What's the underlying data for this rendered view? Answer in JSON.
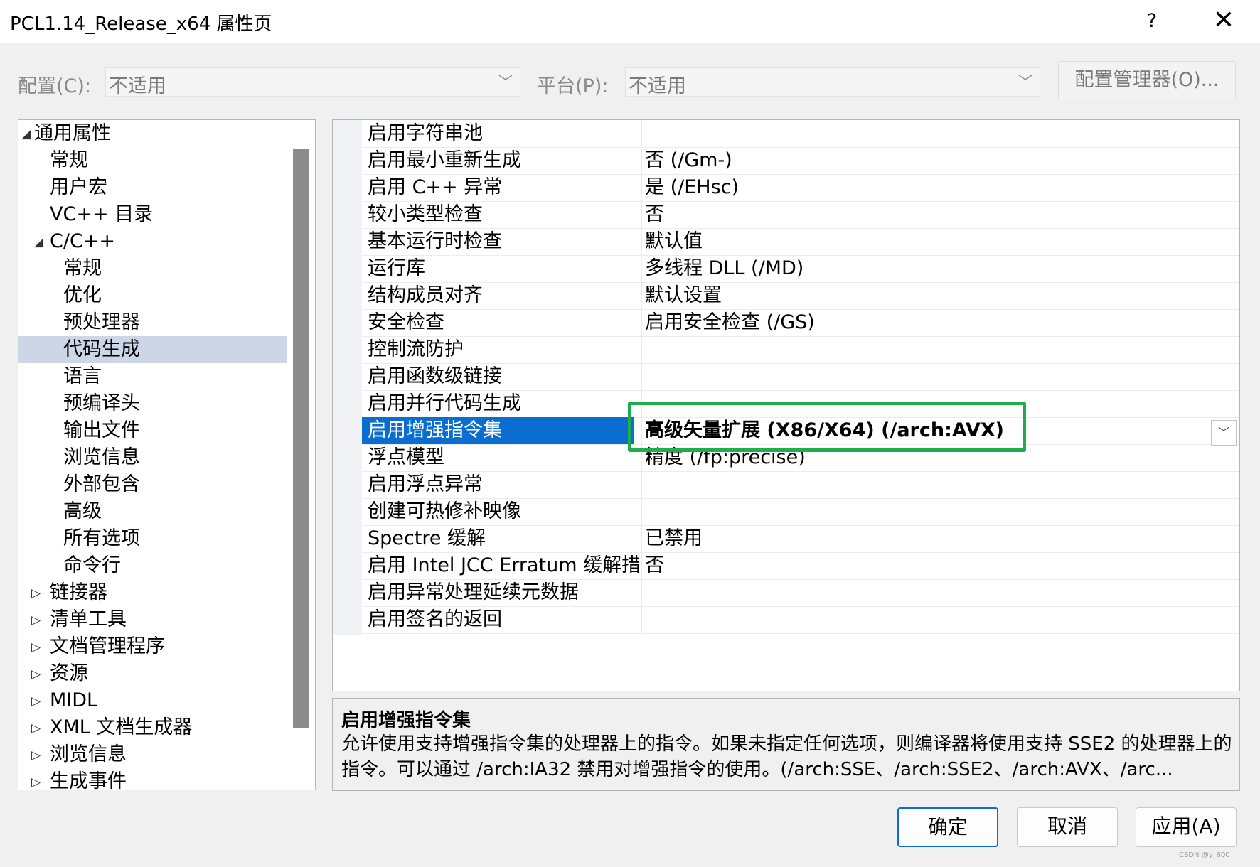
{
  "window": {
    "title": "PCL1.14_Release_x64 属性页",
    "help_label": "?",
    "close_label": "✕"
  },
  "config_bar": {
    "config_label": "配置(C):",
    "config_value": "不适用",
    "platform_label": "平台(P):",
    "platform_value": "不适用",
    "config_manager_label": "配置管理器(O)..."
  },
  "tree": {
    "items": [
      {
        "label": "通用属性",
        "level": 0,
        "expander": "◢",
        "selected": false
      },
      {
        "label": "常规",
        "level": 1,
        "expander": "",
        "selected": false
      },
      {
        "label": "用户宏",
        "level": 1,
        "expander": "",
        "selected": false
      },
      {
        "label": "VC++ 目录",
        "level": 1,
        "expander": "",
        "selected": false
      },
      {
        "label": "C/C++",
        "level": 1,
        "expander": "◢",
        "selected": false
      },
      {
        "label": "常规",
        "level": 2,
        "expander": "",
        "selected": false
      },
      {
        "label": "优化",
        "level": 2,
        "expander": "",
        "selected": false
      },
      {
        "label": "预处理器",
        "level": 2,
        "expander": "",
        "selected": false
      },
      {
        "label": "代码生成",
        "level": 2,
        "expander": "",
        "selected": true
      },
      {
        "label": "语言",
        "level": 2,
        "expander": "",
        "selected": false
      },
      {
        "label": "预编译头",
        "level": 2,
        "expander": "",
        "selected": false
      },
      {
        "label": "输出文件",
        "level": 2,
        "expander": "",
        "selected": false
      },
      {
        "label": "浏览信息",
        "level": 2,
        "expander": "",
        "selected": false
      },
      {
        "label": "外部包含",
        "level": 2,
        "expander": "",
        "selected": false
      },
      {
        "label": "高级",
        "level": 2,
        "expander": "",
        "selected": false
      },
      {
        "label": "所有选项",
        "level": 2,
        "expander": "",
        "selected": false
      },
      {
        "label": "命令行",
        "level": 2,
        "expander": "",
        "selected": false
      },
      {
        "label": "链接器",
        "level": 1,
        "expander": "▷",
        "selected": false
      },
      {
        "label": "清单工具",
        "level": 1,
        "expander": "▷",
        "selected": false
      },
      {
        "label": "文档管理程序",
        "level": 1,
        "expander": "▷",
        "selected": false
      },
      {
        "label": "资源",
        "level": 1,
        "expander": "▷",
        "selected": false
      },
      {
        "label": "MIDL",
        "level": 1,
        "expander": "▷",
        "selected": false
      },
      {
        "label": "XML 文档生成器",
        "level": 1,
        "expander": "▷",
        "selected": false
      },
      {
        "label": "浏览信息",
        "level": 1,
        "expander": "▷",
        "selected": false
      },
      {
        "label": "生成事件",
        "level": 1,
        "expander": "▷",
        "selected": false
      }
    ]
  },
  "grid": {
    "rows": [
      {
        "name": "启用字符串池",
        "value": "",
        "selected": false
      },
      {
        "name": "启用最小重新生成",
        "value": "否 (/Gm-)",
        "selected": false
      },
      {
        "name": "启用 C++ 异常",
        "value": "是 (/EHsc)",
        "selected": false
      },
      {
        "name": "较小类型检查",
        "value": "否",
        "selected": false
      },
      {
        "name": "基本运行时检查",
        "value": "默认值",
        "selected": false
      },
      {
        "name": "运行库",
        "value": "多线程 DLL (/MD)",
        "selected": false
      },
      {
        "name": "结构成员对齐",
        "value": "默认设置",
        "selected": false
      },
      {
        "name": "安全检查",
        "value": "启用安全检查 (/GS)",
        "selected": false
      },
      {
        "name": "控制流防护",
        "value": "",
        "selected": false
      },
      {
        "name": "启用函数级链接",
        "value": "",
        "selected": false
      },
      {
        "name": "启用并行代码生成",
        "value": "",
        "selected": false
      },
      {
        "name": "启用增强指令集",
        "value": "高级矢量扩展 (X86/X64) (/arch:AVX)",
        "selected": true
      },
      {
        "name": "浮点模型",
        "value": "精度 (/fp:precise)",
        "selected": false
      },
      {
        "name": "启用浮点异常",
        "value": "",
        "selected": false
      },
      {
        "name": "创建可热修补映像",
        "value": "",
        "selected": false
      },
      {
        "name": "Spectre 缓解",
        "value": "已禁用",
        "selected": false
      },
      {
        "name": "启用 Intel JCC Erratum 缓解措施",
        "value": "否",
        "selected": false
      },
      {
        "name": "启用异常处理延续元数据",
        "value": "",
        "selected": false
      },
      {
        "name": "启用签名的返回",
        "value": "",
        "selected": false
      }
    ]
  },
  "description": {
    "title": "启用增强指令集",
    "text": "允许使用支持增强指令集的处理器上的指令。如果未指定任何选项，则编译器将使用支持 SSE2 的处理器上的指令。可以通过 /arch:IA32 禁用对增强指令的使用。(/arch:SSE、/arch:SSE2、/arch:AVX、/arc..."
  },
  "buttons": {
    "ok": "确定",
    "cancel": "取消",
    "apply": "应用(A)"
  },
  "watermark": "CSDN @y_600",
  "colors": {
    "selection_blue": "#0a6ed1",
    "tree_selection": "#cdd6e6",
    "highlight_green": "#1fae4b"
  }
}
